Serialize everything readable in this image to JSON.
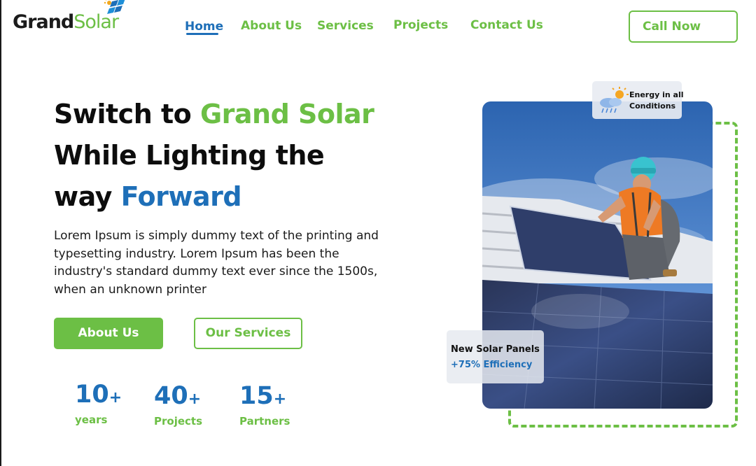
{
  "brand": {
    "part1": "Grand",
    "part2": "Solar"
  },
  "nav": {
    "items": [
      {
        "label": "Home",
        "active": true
      },
      {
        "label": "About Us",
        "active": false
      },
      {
        "label": "Services",
        "active": false
      },
      {
        "label": "Projects",
        "active": false
      },
      {
        "label": "Contact Us",
        "active": false
      }
    ]
  },
  "header": {
    "cta_label": "Call Now"
  },
  "hero": {
    "title_line1_prefix": "Switch to ",
    "title_line1_highlight": "Grand Solar",
    "title_line2": "While Lighting the",
    "title_line3_prefix": "way ",
    "title_line3_highlight": "Forward",
    "description": "Lorem Ipsum is simply dummy text of the printing and typesetting industry. Lorem Ipsum has been the industry's standard dummy text ever since the 1500s, when an unknown printer",
    "primary_button": "About Us",
    "secondary_button": "Our Services"
  },
  "stats": [
    {
      "value": "10",
      "suffix": "+",
      "label": "years"
    },
    {
      "value": "40",
      "suffix": "+",
      "label": "Projects"
    },
    {
      "value": "15",
      "suffix": "+",
      "label": "Partners"
    }
  ],
  "badges": {
    "energy_line1": "Energy in all",
    "energy_line2": "Conditions",
    "panels_title": "New Solar Panels",
    "panels_subtitle": "+75% Efficiency"
  },
  "colors": {
    "green": "#6cbf45",
    "blue": "#1e6fb8",
    "text": "#0d0d0d"
  }
}
